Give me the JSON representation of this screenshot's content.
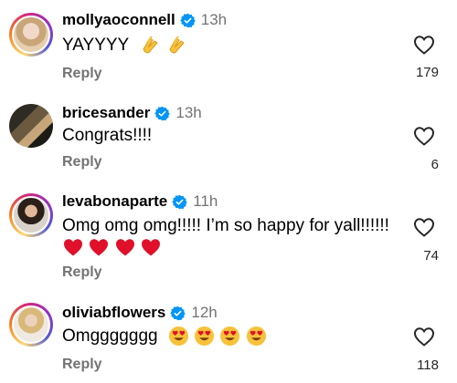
{
  "comments": [
    {
      "username": "mollyaoconnell",
      "time": "13h",
      "text": "YAYYYY",
      "emojis": [
        "clapping-hands",
        "clapping-hands"
      ],
      "reply_label": "Reply",
      "likes": "179"
    },
    {
      "username": "bricesander",
      "time": "13h",
      "text": "Congrats!!!!",
      "emojis": [],
      "reply_label": "Reply",
      "likes": "6"
    },
    {
      "username": "levabonaparte",
      "time": "11h",
      "text": "Omg omg omg!!!!! I’m so happy for yall!!!!!!",
      "emojis": [
        "red-heart",
        "red-heart",
        "red-heart",
        "red-heart"
      ],
      "reply_label": "Reply",
      "likes": "74"
    },
    {
      "username": "oliviabflowers",
      "time": "12h",
      "text": "Omggggggg",
      "emojis": [
        "heart-eyes",
        "heart-eyes",
        "heart-eyes",
        "heart-eyes"
      ],
      "reply_label": "Reply",
      "likes": "118"
    }
  ],
  "colors": {
    "verified_blue": "#0095f6",
    "secondary_text": "#737373",
    "heart_red": "#e0102a",
    "emoji_yellow": "#f7c23a"
  },
  "icons": {
    "like": "heart-outline-icon",
    "verified": "verified-badge-icon"
  }
}
